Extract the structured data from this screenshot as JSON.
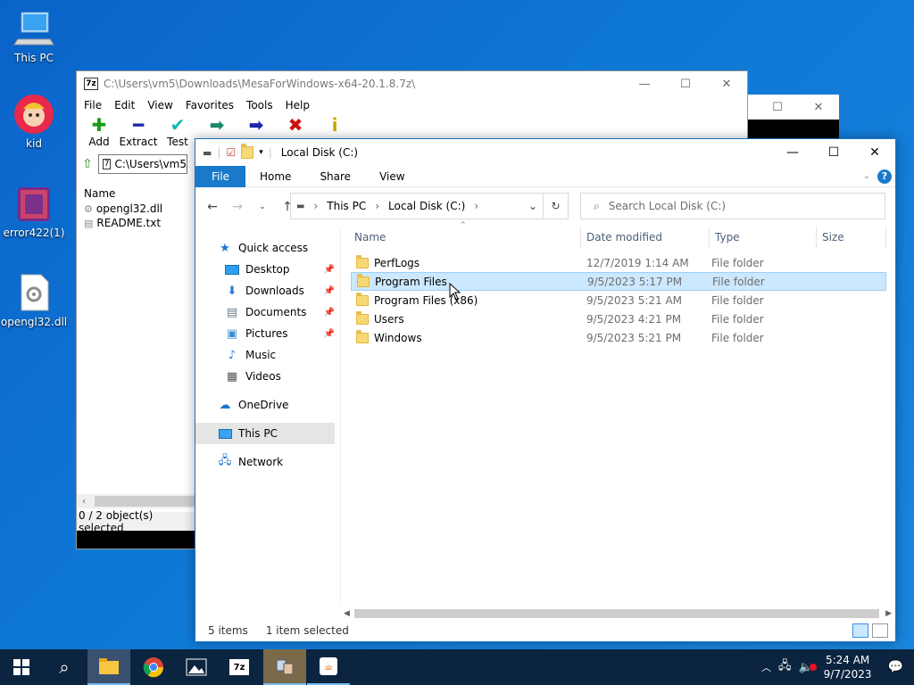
{
  "desktop": {
    "icons": [
      {
        "label": "This PC",
        "icon": "computer-icon"
      },
      {
        "label": "kid",
        "icon": "character-icon"
      },
      {
        "label": "error422(1)",
        "icon": "archive-icon"
      },
      {
        "label": "opengl32.dll",
        "icon": "dll-file-icon"
      }
    ]
  },
  "sevenzip": {
    "title": "C:\\Users\\vm5\\Downloads\\MesaForWindows-x64-20.1.8.7z\\",
    "app_icon_text": "7z",
    "menu": [
      "File",
      "Edit",
      "View",
      "Favorites",
      "Tools",
      "Help"
    ],
    "tools": [
      {
        "label": "Add",
        "icon": "plus-icon",
        "color": "#1c9b1c"
      },
      {
        "label": "Extract",
        "icon": "minus-icon",
        "color": "#1d28a8"
      },
      {
        "label": "Test",
        "icon": "check-icon",
        "color": "#10b8b8"
      }
    ],
    "address": "C:\\Users\\vm5\\",
    "column_name": "Name",
    "files": [
      {
        "name": "opengl32.dll",
        "icon": "dll-file-icon"
      },
      {
        "name": "README.txt",
        "icon": "text-file-icon"
      }
    ],
    "status": "0 / 2 object(s) selected"
  },
  "explorer": {
    "title": "Local Disk (C:)",
    "ribbon": {
      "file": "File",
      "tabs": [
        "Home",
        "Share",
        "View"
      ]
    },
    "breadcrumb": [
      "This PC",
      "Local Disk (C:)"
    ],
    "search_placeholder": "Search Local Disk (C:)",
    "nav": {
      "quick_access": "Quick access",
      "items": [
        {
          "label": "Desktop",
          "icon": "desktop-icon",
          "pinned": true
        },
        {
          "label": "Downloads",
          "icon": "download-icon",
          "pinned": true
        },
        {
          "label": "Documents",
          "icon": "documents-icon",
          "pinned": true
        },
        {
          "label": "Pictures",
          "icon": "pictures-icon",
          "pinned": true
        },
        {
          "label": "Music",
          "icon": "music-icon",
          "pinned": false
        },
        {
          "label": "Videos",
          "icon": "videos-icon",
          "pinned": false
        }
      ],
      "onedrive": "OneDrive",
      "this_pc": "This PC",
      "network": "Network"
    },
    "columns": [
      "Name",
      "Date modified",
      "Type",
      "Size"
    ],
    "rows": [
      {
        "name": "PerfLogs",
        "date": "12/7/2019 1:14 AM",
        "type": "File folder",
        "selected": false
      },
      {
        "name": "Program Files",
        "date": "9/5/2023 5:17 PM",
        "type": "File folder",
        "selected": true
      },
      {
        "name": "Program Files (x86)",
        "date": "9/5/2023 5:21 AM",
        "type": "File folder",
        "selected": false
      },
      {
        "name": "Users",
        "date": "9/5/2023 4:21 PM",
        "type": "File folder",
        "selected": false
      },
      {
        "name": "Windows",
        "date": "9/5/2023 5:21 PM",
        "type": "File folder",
        "selected": false
      }
    ],
    "status": {
      "items": "5 items",
      "selected": "1 item selected"
    }
  },
  "taskbar": {
    "apps": [
      "start-icon",
      "search-icon",
      "file-explorer-icon",
      "chrome-icon",
      "photos-icon",
      "7zip-icon",
      "network-app-icon",
      "java-icon"
    ],
    "time": "5:24 AM",
    "date": "9/7/2023"
  }
}
